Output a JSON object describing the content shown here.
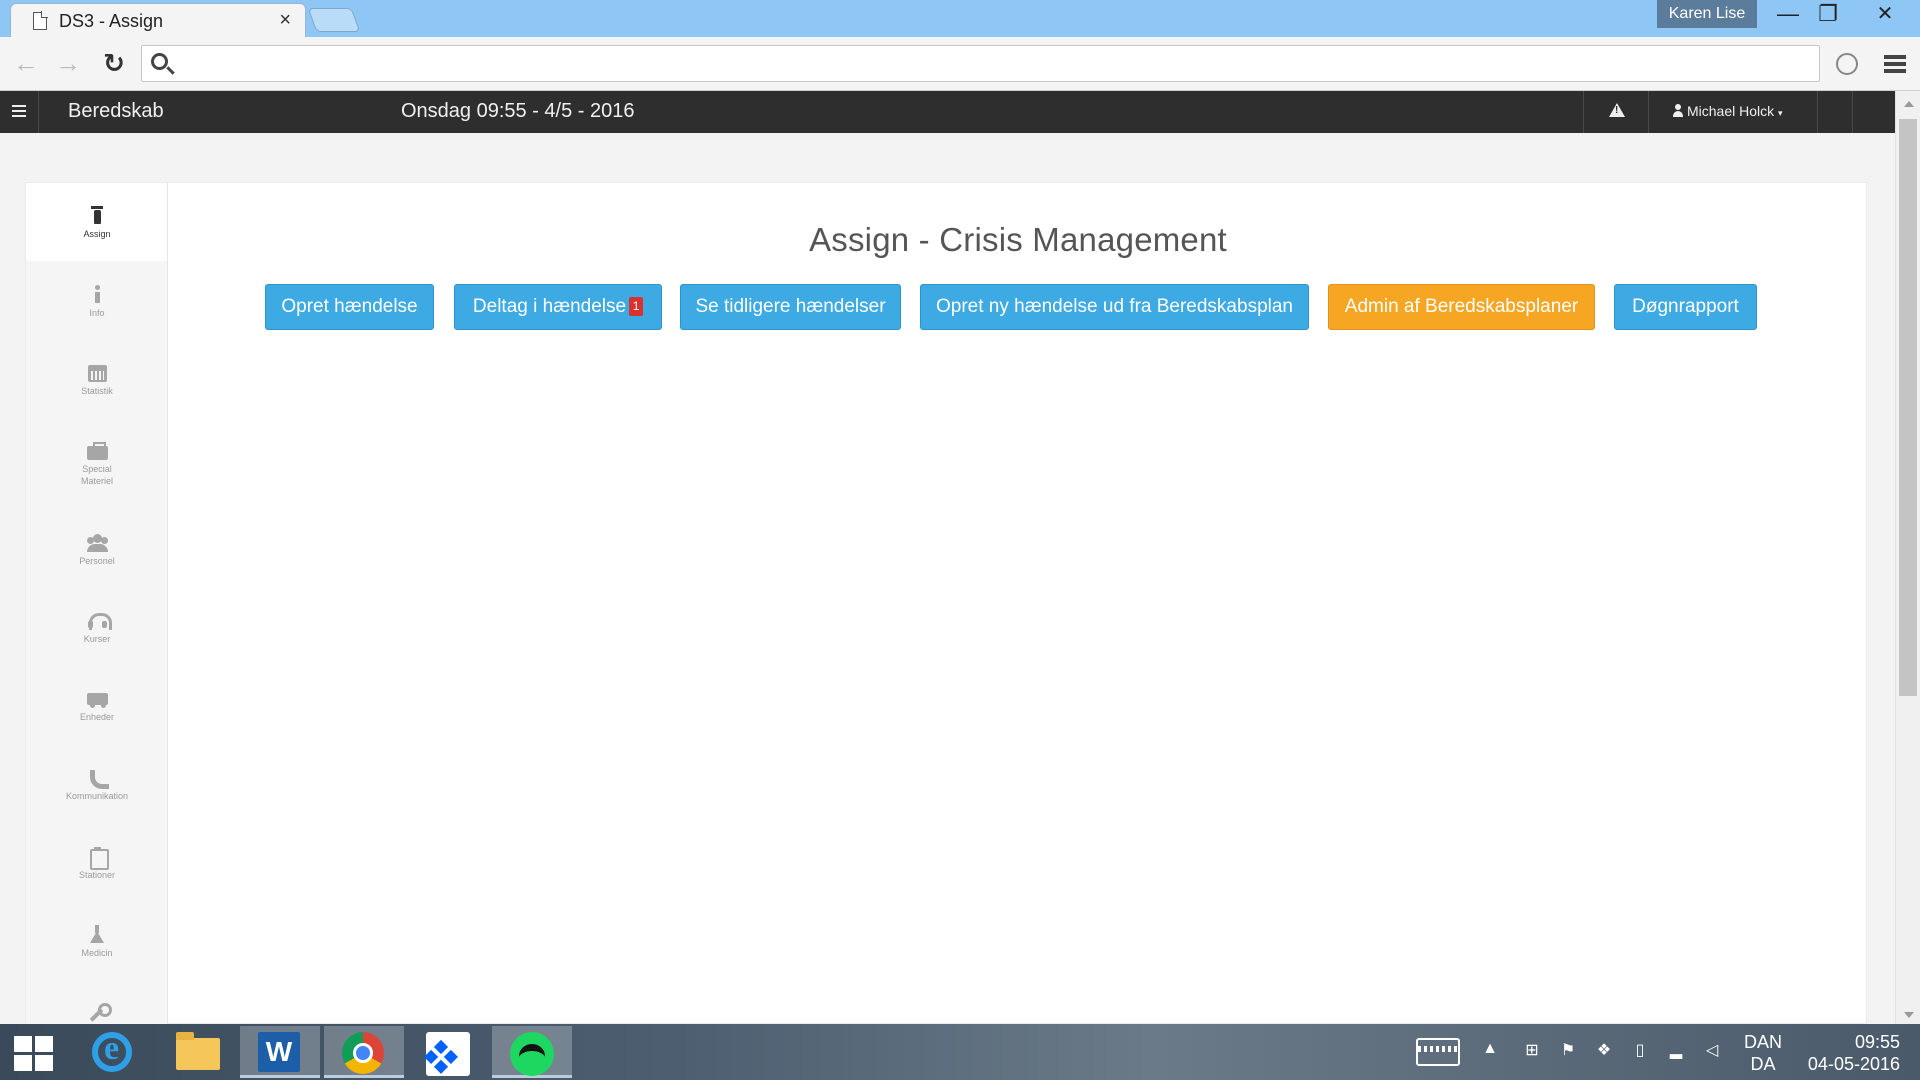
{
  "browser": {
    "tab_title": "DS3 - Assign",
    "tab_close": "×",
    "profile_name": "Karen Lise",
    "window_minimize": "—",
    "window_restore": "❐",
    "window_close": "✕",
    "address_value": ""
  },
  "navbar": {
    "brand": "Beredskab",
    "datetime": "Onsdag 09:55 - 4/5 - 2016",
    "user": "Michael Holck",
    "user_caret": "▾"
  },
  "sidebar": {
    "items": [
      {
        "label": "Assign",
        "icon": "fire-extinguisher-icon"
      },
      {
        "label": "Info",
        "icon": "info-icon"
      },
      {
        "label": "Statistik",
        "icon": "calendar-icon"
      },
      {
        "label": "Special Materiel",
        "icon": "briefcase-icon"
      },
      {
        "label": "Personel",
        "icon": "group-icon"
      },
      {
        "label": "Kurser",
        "icon": "headset-icon"
      },
      {
        "label": "Enheder",
        "icon": "ambulance-icon"
      },
      {
        "label": "Kommunikation",
        "icon": "phone-icon"
      },
      {
        "label": "Stationer",
        "icon": "clipboard-icon"
      },
      {
        "label": "Medicin",
        "icon": "flask-icon"
      },
      {
        "label": "",
        "icon": "wrench-icon"
      }
    ]
  },
  "main": {
    "title": "Assign - Crisis Management",
    "buttons": [
      {
        "label": "Opret hændelse",
        "color": "#3daae4"
      },
      {
        "label": "Deltag i hændelse",
        "badge": "1",
        "color": "#3daae4"
      },
      {
        "label": "Se tidligere hændelser",
        "color": "#3daae4"
      },
      {
        "label": "Opret ny hændelse ud fra Beredskabsplan",
        "color": "#3daae4"
      },
      {
        "label": "Admin af Beredskabsplaner",
        "color": "#f6a623"
      },
      {
        "label": "Døgnrapport",
        "color": "#3daae4"
      }
    ]
  },
  "taskbar": {
    "apps": [
      "start",
      "internet-explorer",
      "file-explorer",
      "word",
      "chrome",
      "dropbox",
      "spotify"
    ],
    "lang_top": "DAN",
    "lang_bottom": "DA",
    "time": "09:55",
    "date": "04-05-2016"
  }
}
